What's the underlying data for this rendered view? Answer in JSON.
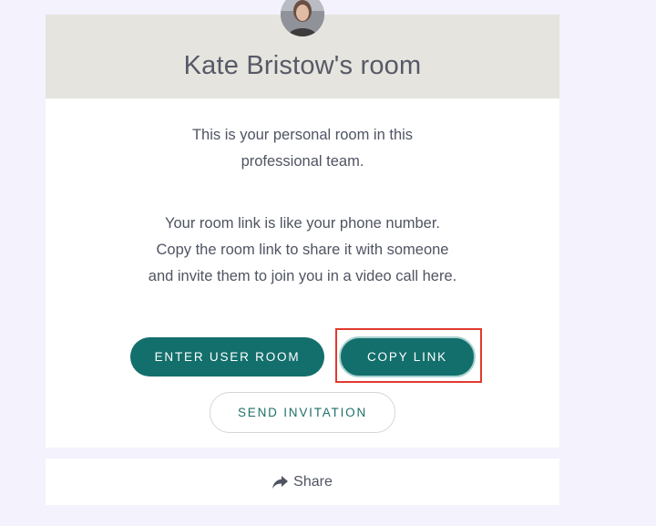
{
  "room": {
    "title": "Kate Bristow's room",
    "intro": "This is your personal room in this professional team.",
    "link_description": "Your room link is like your phone number. Copy the room link to share it with someone and invite them to join you in a video call here."
  },
  "actions": {
    "enter_label": "ENTER USER ROOM",
    "copy_label": "COPY LINK",
    "invite_label": "SEND INVITATION"
  },
  "share": {
    "label": "Share",
    "icon": "share-arrow-icon"
  },
  "colors": {
    "page_background": "#f3f2fd",
    "header_background": "#e6e4de",
    "primary_button": "#136f6c",
    "highlight": "#e23a2e"
  }
}
